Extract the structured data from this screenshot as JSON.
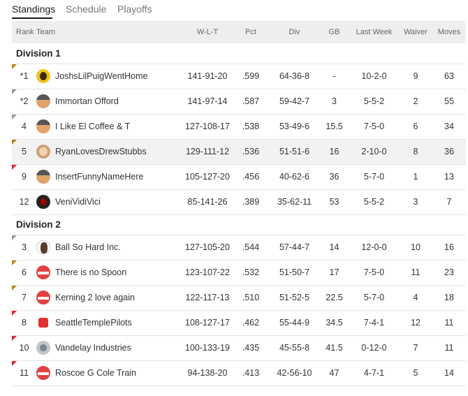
{
  "tabs": [
    {
      "label": "Standings"
    },
    {
      "label": "Schedule"
    },
    {
      "label": "Playoffs"
    }
  ],
  "columns": {
    "rank": "Rank",
    "team": "Team",
    "wlt": "W-L-T",
    "pct": "Pct",
    "div": "Div",
    "gb": "GB",
    "last_week": "Last Week",
    "waiver": "Waiver",
    "moves": "Moves"
  },
  "divisions": [
    {
      "name": "Division 1",
      "teams": [
        {
          "rank": "*1",
          "trend": "up",
          "avatar": "bee",
          "team": "JoshsLilPuigWentHome",
          "wlt": "141-91-20",
          "pct": ".599",
          "div": "64-36-8",
          "gb": "-",
          "last_week": "10-2-0",
          "waiver": "9",
          "moves": "63"
        },
        {
          "rank": "*2",
          "trend": "same",
          "avatar": "hat",
          "team": "Immortan Offord",
          "wlt": "141-97-14",
          "pct": ".587",
          "div": "59-42-7",
          "gb": "3",
          "last_week": "5-5-2",
          "waiver": "2",
          "moves": "55"
        },
        {
          "rank": "4",
          "trend": "same",
          "avatar": "hat",
          "team": "I Like El Coffee & T",
          "wlt": "127-108-17",
          "pct": ".538",
          "div": "53-49-6",
          "gb": "15.5",
          "last_week": "7-5-0",
          "waiver": "6",
          "moves": "34"
        },
        {
          "rank": "5",
          "trend": "up",
          "avatar": "face",
          "team": "RyanLovesDrewStubbs",
          "wlt": "129-111-12",
          "pct": ".536",
          "div": "51-51-6",
          "gb": "16",
          "last_week": "2-10-0",
          "waiver": "8",
          "moves": "36",
          "highlight": true
        },
        {
          "rank": "9",
          "trend": "down",
          "avatar": "hat",
          "team": "InsertFunnyNameHere",
          "wlt": "105-127-20",
          "pct": ".456",
          "div": "40-62-6",
          "gb": "36",
          "last_week": "5-7-0",
          "waiver": "1",
          "moves": "13"
        },
        {
          "rank": "12",
          "trend": "none",
          "avatar": "dark",
          "team": "VeniVidiVici",
          "wlt": "85-141-26",
          "pct": ".389",
          "div": "35-62-11",
          "gb": "53",
          "last_week": "5-5-2",
          "waiver": "3",
          "moves": "7"
        }
      ]
    },
    {
      "name": "Division 2",
      "teams": [
        {
          "rank": "3",
          "trend": "same",
          "avatar": "man",
          "team": "Ball So Hard Inc.",
          "wlt": "127-105-20",
          "pct": ".544",
          "div": "57-44-7",
          "gb": "14",
          "last_week": "12-0-0",
          "waiver": "10",
          "moves": "16"
        },
        {
          "rank": "6",
          "trend": "up",
          "avatar": "helmet",
          "team": "There is no Spoon",
          "wlt": "123-107-22",
          "pct": ".532",
          "div": "51-50-7",
          "gb": "17",
          "last_week": "7-5-0",
          "waiver": "11",
          "moves": "23"
        },
        {
          "rank": "7",
          "trend": "up",
          "avatar": "helmet",
          "team": "Kerning 2 love again",
          "wlt": "122-117-13",
          "pct": ".510",
          "div": "51-52-5",
          "gb": "22.5",
          "last_week": "5-7-0",
          "waiver": "4",
          "moves": "18"
        },
        {
          "rank": "8",
          "trend": "down",
          "avatar": "shirt",
          "team": "SeattleTemplePilots",
          "wlt": "108-127-17",
          "pct": ".462",
          "div": "55-44-9",
          "gb": "34.5",
          "last_week": "7-4-1",
          "waiver": "12",
          "moves": "11"
        },
        {
          "rank": "10",
          "trend": "down",
          "avatar": "grey",
          "team": "Vandelay Industries",
          "wlt": "100-133-19",
          "pct": ".435",
          "div": "45-55-8",
          "gb": "41.5",
          "last_week": "0-12-0",
          "waiver": "7",
          "moves": "11"
        },
        {
          "rank": "11",
          "trend": "down",
          "avatar": "helmet",
          "team": "Roscoe G Cole Train",
          "wlt": "94-138-20",
          "pct": ".413",
          "div": "42-56-10",
          "gb": "47",
          "last_week": "4-7-1",
          "waiver": "5",
          "moves": "14"
        }
      ]
    }
  ]
}
